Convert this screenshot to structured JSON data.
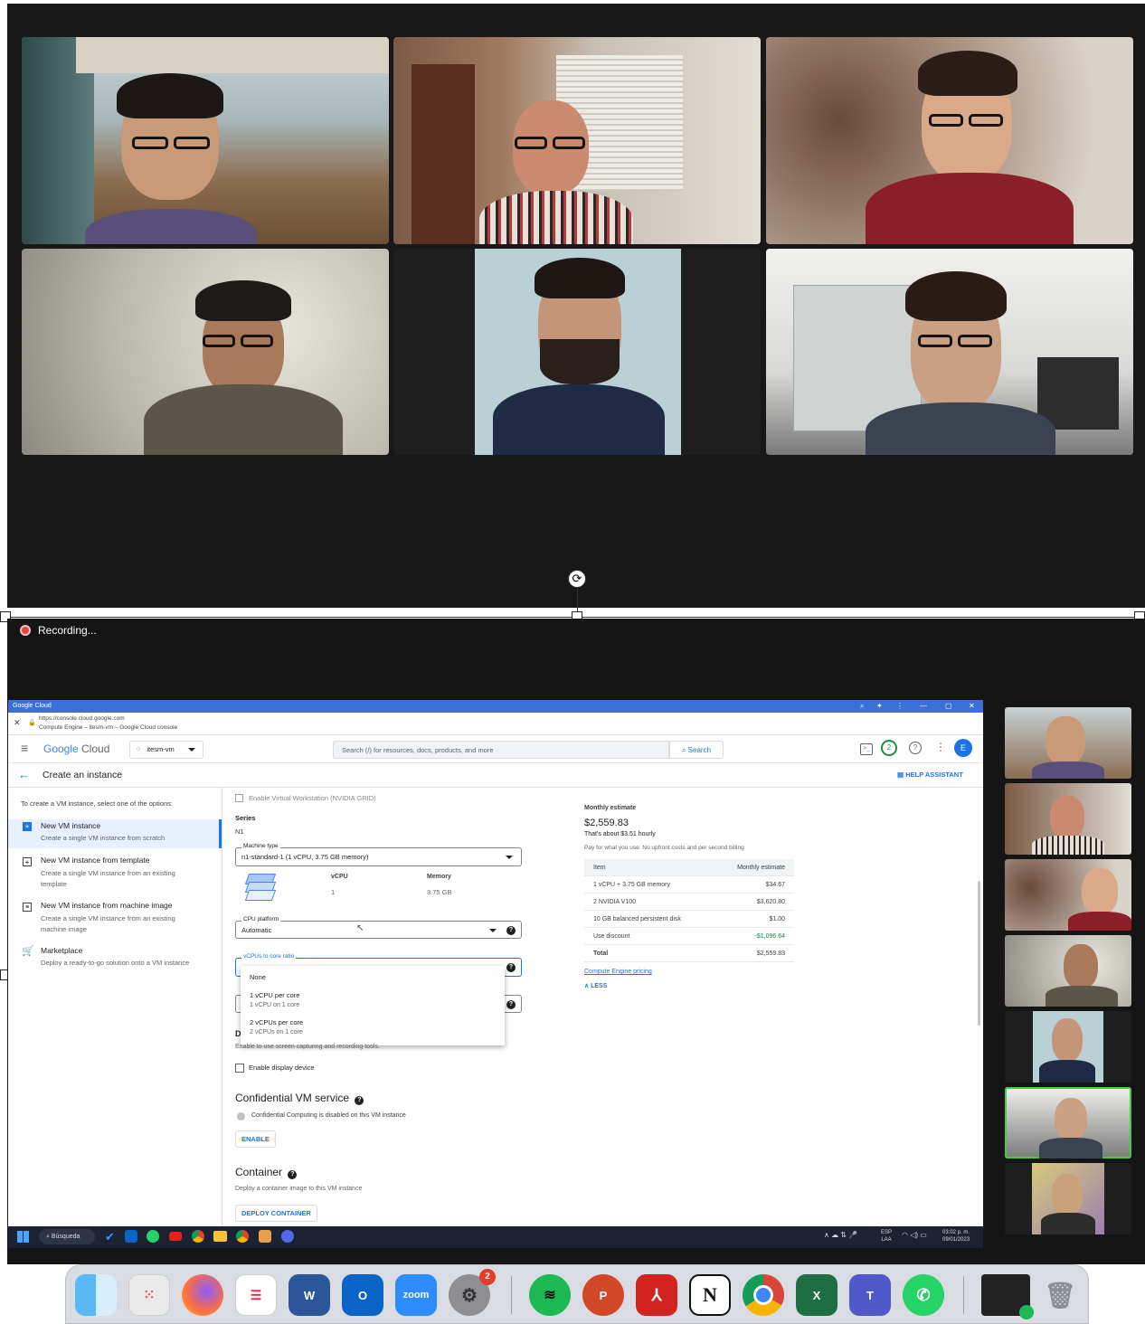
{
  "recording": {
    "label": "Recording..."
  },
  "browser": {
    "window_title": "Google Cloud",
    "url": "https://console.cloud.google.com",
    "page_title": "Compute Engine – itesm-vm – Google Cloud console",
    "logo_google": "Google",
    "logo_cloud": "Cloud",
    "project": "itesm-vm",
    "search_placeholder": "Search (/) for resources, docs, products, and more",
    "search_button": "Search",
    "notification_count": "2",
    "avatar_letter": "E",
    "page_heading": "Create an instance",
    "help_assistant": "HELP ASSISTANT"
  },
  "sidebar": {
    "intro": "To create a VM instance, select one of the options:",
    "items": [
      {
        "title": "New VM instance",
        "desc": "Create a single VM instance from scratch"
      },
      {
        "title": "New VM instance from template",
        "desc": "Create a single VM instance from an existing template"
      },
      {
        "title": "New VM instance from machine image",
        "desc": "Create a single VM instance from an existing machine image"
      },
      {
        "title": "Marketplace",
        "desc": "Deploy a ready-to-go solution onto a VM instance"
      }
    ]
  },
  "form": {
    "virtual_workstation": "Enable Virtual Workstation (NVIDIA GRID)",
    "series_label": "Series",
    "series_value": "N1",
    "machine_type_legend": "Machine type",
    "machine_type_value": "n1-standard-1 (1 vCPU, 3.75 GB memory)",
    "vcpu_header": "vCPU",
    "vcpu_value": "1",
    "memory_header": "Memory",
    "memory_value": "3.75 GB",
    "cpu_platform_legend": "CPU platform",
    "cpu_platform_value": "Automatic",
    "vcpu_ratio_legend": "vCPUs to core ratio",
    "dropdown_options": [
      {
        "label": "None",
        "sub": ""
      },
      {
        "label": "1 vCPU per core",
        "sub": "1 vCPU on 1 core"
      },
      {
        "label": "2 vCPUs per core",
        "sub": "2 vCPUs on 1 core"
      }
    ],
    "display_partial": "D",
    "display_desc": "Enable to use screen capturing and recording tools.",
    "display_checkbox": "Enable display device",
    "confidential_title": "Confidential VM service",
    "confidential_desc": "Confidential Computing is disabled on this VM instance",
    "enable_button": "ENABLE",
    "container_title": "Container",
    "container_desc": "Deploy a container image to this VM instance",
    "deploy_container_button": "DEPLOY CONTAINER"
  },
  "estimate": {
    "title": "Monthly estimate",
    "total_big": "$2,559.83",
    "hourly": "That's about $3.51 hourly",
    "note": "Pay for what you use: No upfront costs and per second billing",
    "col_item": "Item",
    "col_estimate": "Monthly estimate",
    "rows": [
      {
        "item": "1 vCPU + 3.75 GB memory",
        "value": "$34.67"
      },
      {
        "item": "2 NVIDIA V100",
        "value": "$3,620.80"
      },
      {
        "item": "10 GB balanced persistent disk",
        "value": "$1.00"
      },
      {
        "item": "Use discount",
        "value": "-$1,096.64"
      },
      {
        "item": "Total",
        "value": "$2,559.83"
      }
    ],
    "pricing_link": "Compute Engine pricing",
    "less": "LESS"
  },
  "win_taskbar": {
    "search": "Búsqueda",
    "lang_top": "ESP",
    "lang_bottom": "LAA",
    "time": "03:02 p. m.",
    "date": "09/01/2023"
  },
  "dock": {
    "zoom_label": "zoom",
    "settings_badge": "2"
  },
  "colors": {
    "active_speaker": "#3fcf3f",
    "google_blue": "#1a73e8",
    "titlebar": "#3c6fd8"
  }
}
